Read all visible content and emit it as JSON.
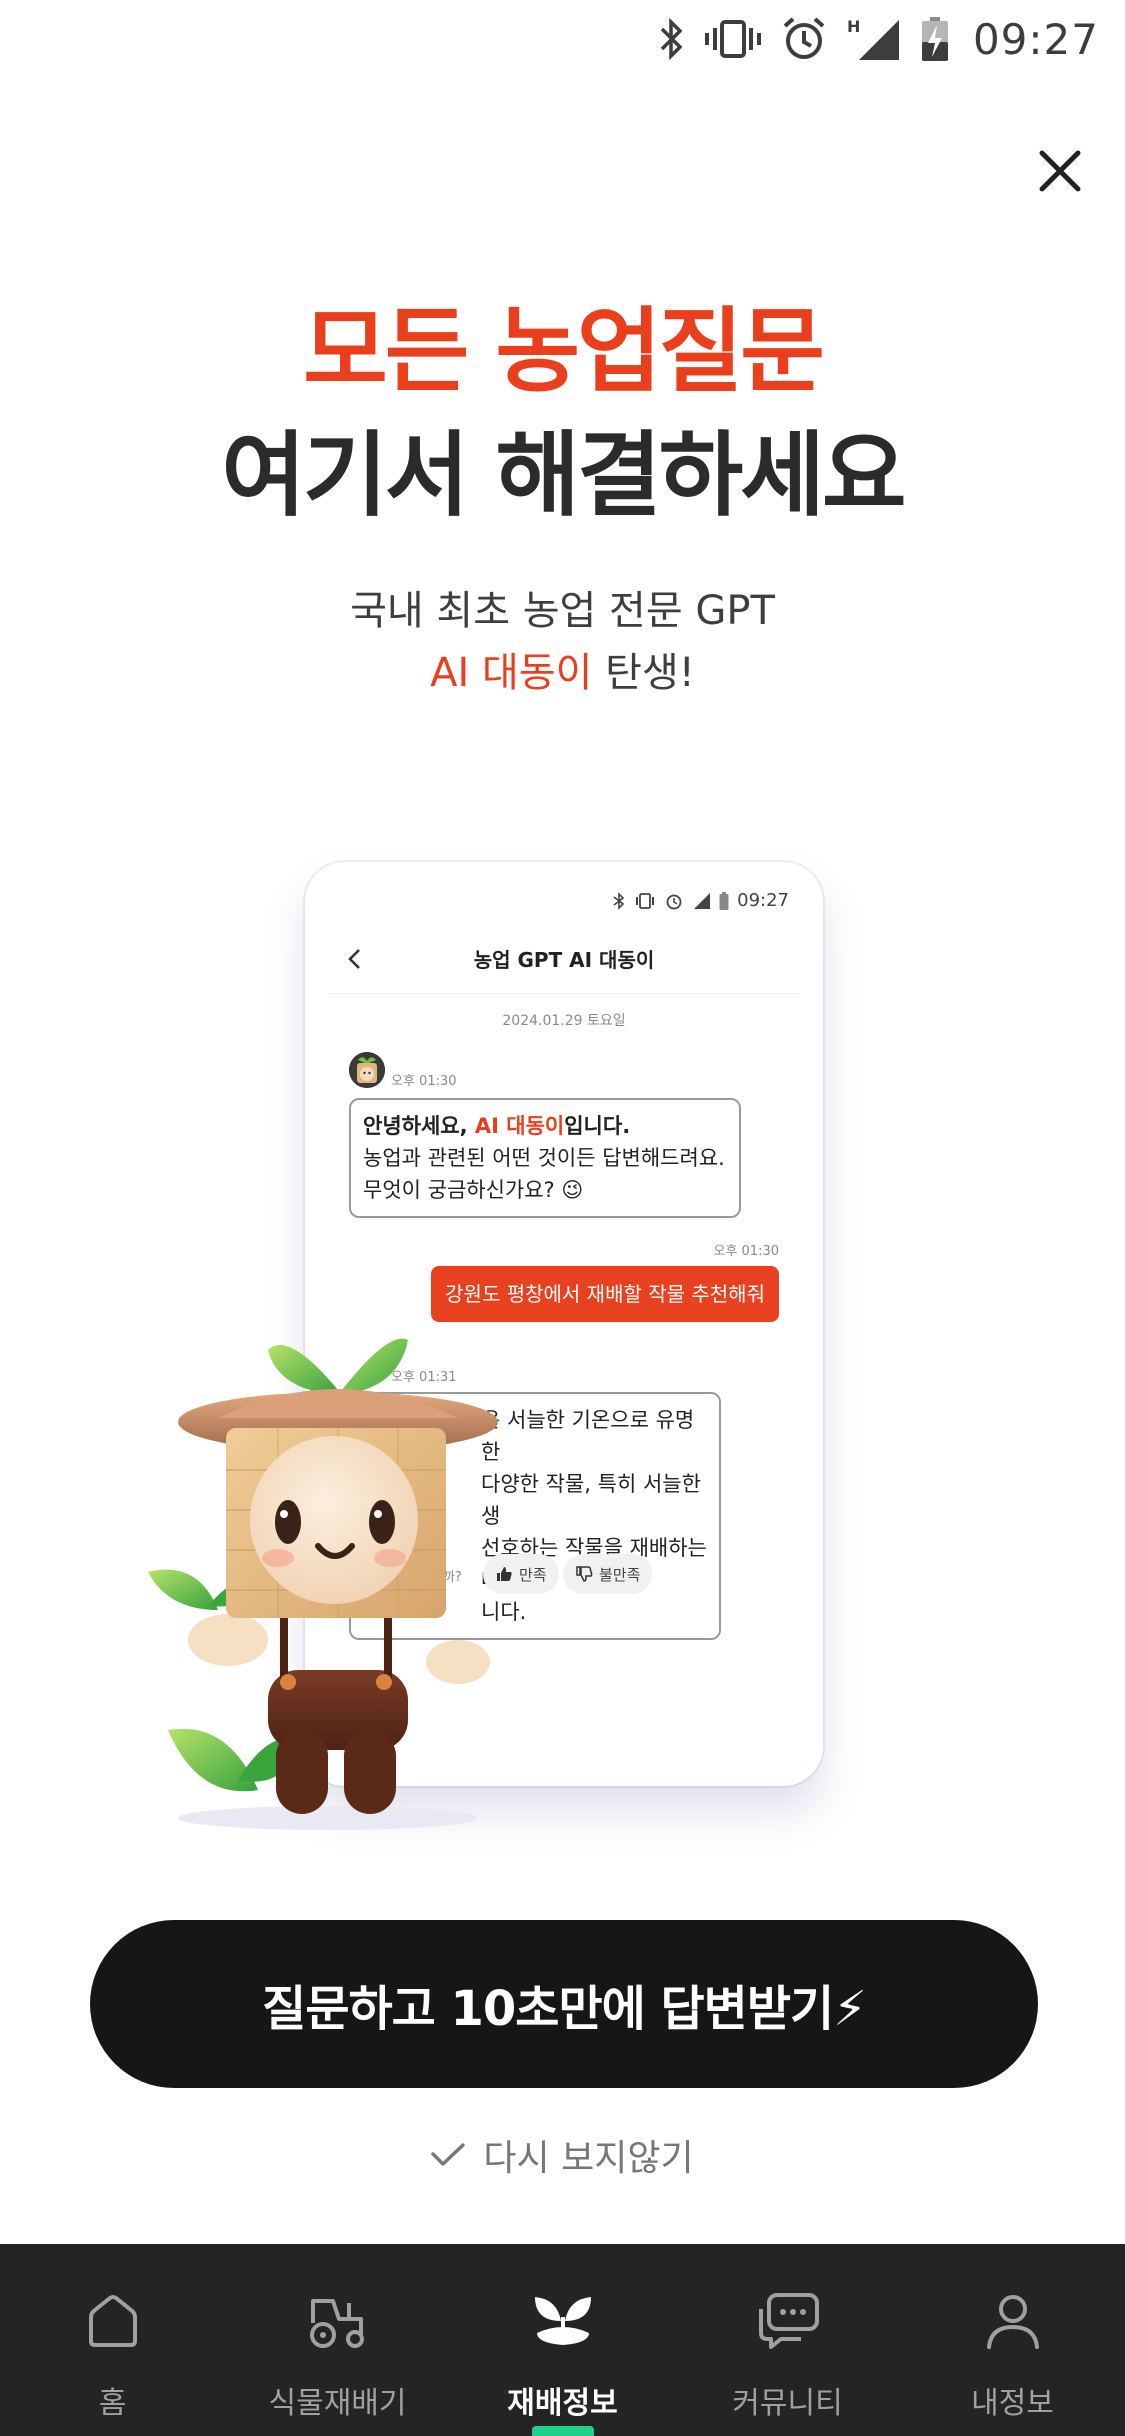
{
  "status_bar": {
    "time": "09:27"
  },
  "hero": {
    "headline_line1": "모든 농업질문",
    "headline_line2": "여기서 해결하세요",
    "sub_line1": "국내 최초 농업 전문 GPT",
    "sub_line2_accent": "AI 대동이",
    "sub_line2_rest": " 탄생!"
  },
  "phone_preview": {
    "status_time": "09:27",
    "title": "농업 GPT AI 대동이",
    "date": "2024.01.29 토요일",
    "msg1_time": "오후 01:30",
    "msg1_line1_pre": "안녕하세요, ",
    "msg1_line1_accent": "AI 대동이",
    "msg1_line1_post": "입니다.",
    "msg1_line2": "농업과 관련된 어떤 것이든 답변해드려요.",
    "msg1_line3": "무엇이 궁금하신가요? 😉",
    "msg2_time": "오후 01:30",
    "msg2_text": "강원도 평창에서 재배할 작물 추천해줘",
    "msg3_time": "오후 01:31",
    "msg3_line1": "은 서늘한 기온으로 유명한",
    "msg3_line2": "다양한 작물, 특히 서늘한 생",
    "msg3_line3": "선호하는 작물을 재배하는데",
    "msg3_line4": "니다.",
    "feedback_text": "니까?",
    "feedback_good": "만족",
    "feedback_bad": "불만족"
  },
  "cta": {
    "label": "질문하고 10초만에 답변받기⚡"
  },
  "dont_show": {
    "label": "다시 보지않기"
  },
  "bottom_nav": {
    "items": [
      {
        "label": "홈",
        "icon": "home-icon"
      },
      {
        "label": "식물재배기",
        "icon": "tractor-icon"
      },
      {
        "label": "재배정보",
        "icon": "sprout-icon",
        "active": true
      },
      {
        "label": "커뮤니티",
        "icon": "chat-bubbles-icon"
      },
      {
        "label": "내정보",
        "icon": "person-icon"
      }
    ]
  },
  "colors": {
    "accent": "#ea3f1c",
    "nav_bg": "#242424",
    "nav_indicator": "#1fd18a",
    "cta_bg": "#161616"
  }
}
